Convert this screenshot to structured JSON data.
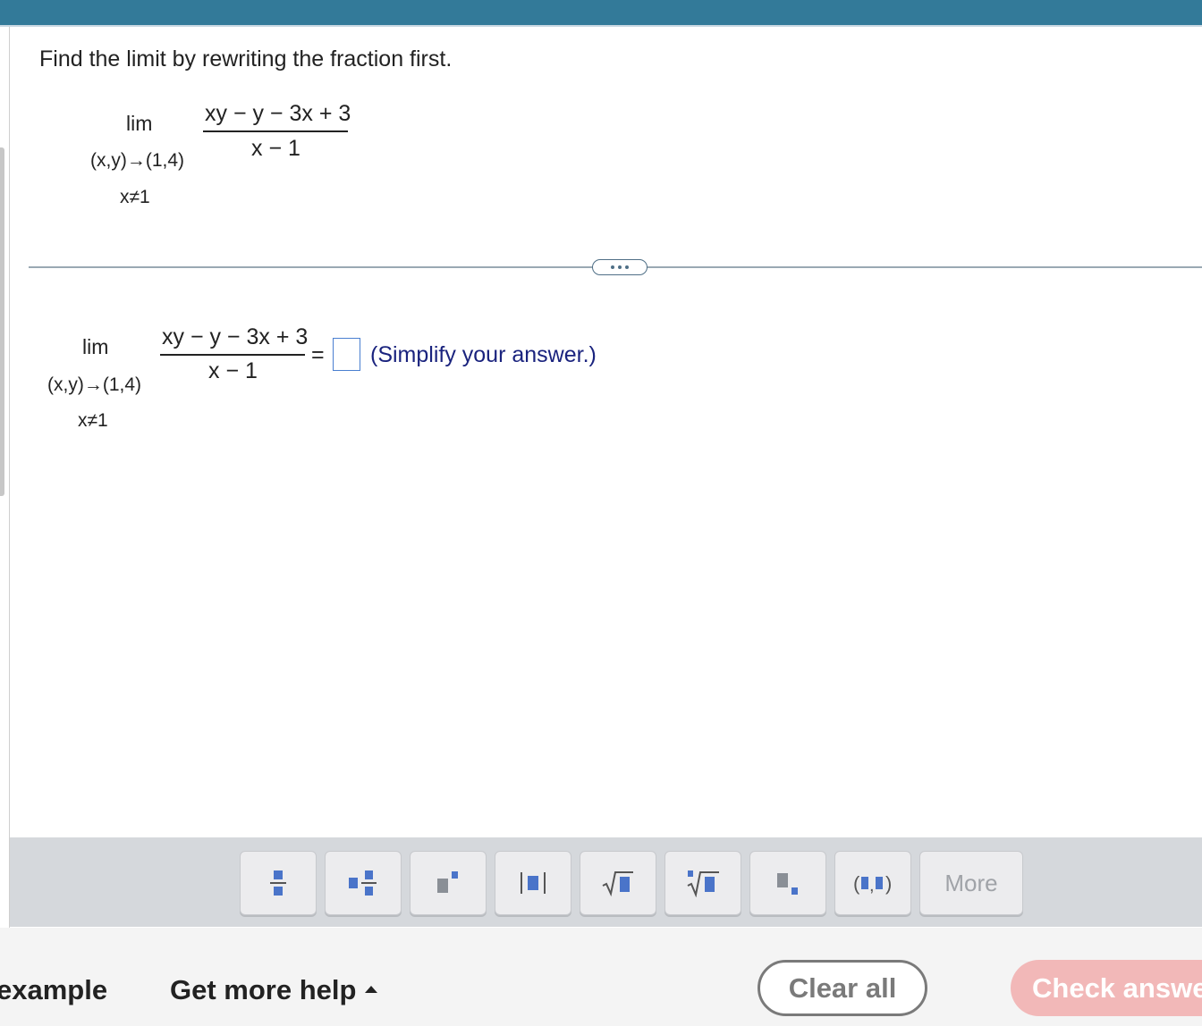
{
  "problem": {
    "instruction": "Find the limit by rewriting the fraction first.",
    "expression": {
      "lim": "lim",
      "approach": "(x,y)→(1,4)",
      "condition": "x≠1",
      "numerator": "xy − y − 3x + 3",
      "denominator": "x − 1"
    }
  },
  "answer": {
    "lim": "lim",
    "approach": "(x,y)→(1,4)",
    "condition": "x≠1",
    "numerator": "xy − y − 3x + 3",
    "denominator": "x − 1",
    "equals": "=",
    "value": "",
    "hint": "(Simplify your answer.)"
  },
  "toolbar": {
    "buttons": [
      {
        "name": "fraction-icon"
      },
      {
        "name": "mixed-number-icon"
      },
      {
        "name": "exponent-icon"
      },
      {
        "name": "absolute-value-icon"
      },
      {
        "name": "square-root-icon"
      },
      {
        "name": "nth-root-icon"
      },
      {
        "name": "subscript-icon"
      },
      {
        "name": "ordered-pair-icon"
      }
    ],
    "more_label": "More"
  },
  "footer": {
    "example_label": "example",
    "help_label": "Get more help",
    "clear_label": "Clear all",
    "check_label": "Check answer"
  },
  "colors": {
    "header": "#337a99",
    "icon_blue": "#4a74c9",
    "hint_text": "#1a237e",
    "check_button": "#f2b8b8"
  }
}
